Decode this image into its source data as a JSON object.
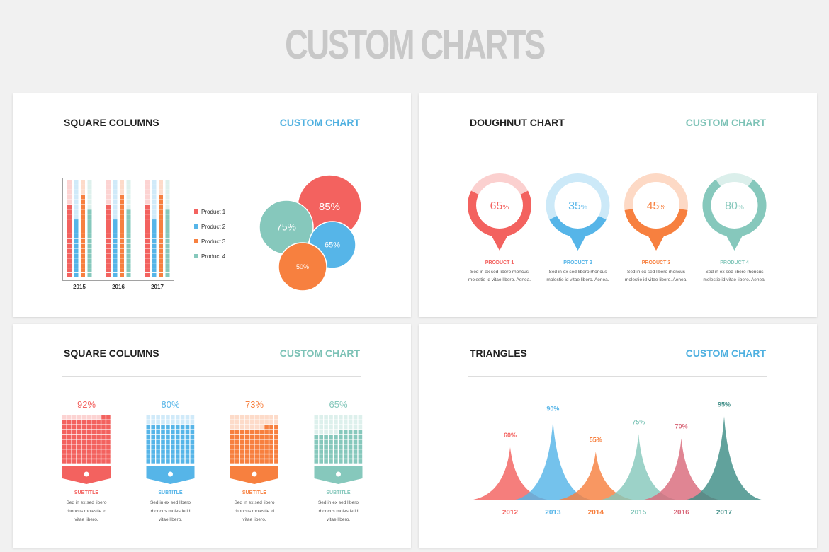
{
  "title": "CUSTOM CHARTS",
  "colors": {
    "red": "#f3625f",
    "blue": "#56b5e8",
    "orange": "#f7803f",
    "teal": "#86c8bc",
    "pink": "#d96a7b",
    "darkteal": "#3e8d86"
  },
  "panels": [
    {
      "title": "SQUARE COLUMNS",
      "subtitle": "CUSTOM CHART",
      "subtitle_color": "#4fb0e0"
    },
    {
      "title": "DOUGHNUT CHART",
      "subtitle": "CUSTOM CHART",
      "subtitle_color": "#7cc2b6"
    },
    {
      "title": "SQUARE COLUMNS",
      "subtitle": "CUSTOM CHART",
      "subtitle_color": "#7cc2b6"
    },
    {
      "title": "TRIANGLES",
      "subtitle": "CUSTOM CHART",
      "subtitle_color": "#4fb0e0"
    }
  ],
  "chart_data": [
    {
      "type": "bar",
      "categories": [
        "2015",
        "2016",
        "2017"
      ],
      "units_per_column": 20,
      "series": [
        {
          "name": "Product 1",
          "values": [
            15,
            15,
            15
          ]
        },
        {
          "name": "Product 2",
          "values": [
            12,
            12,
            12
          ]
        },
        {
          "name": "Product 3",
          "values": [
            17,
            17,
            17
          ]
        },
        {
          "name": "Product 4",
          "values": [
            14,
            14,
            14
          ]
        }
      ],
      "legend": "right"
    },
    {
      "type": "bubble",
      "labels": [
        "85%",
        "75%",
        "65%",
        "50%"
      ],
      "values": [
        85,
        75,
        65,
        50
      ],
      "colors": [
        "#f3625f",
        "#86c8bc",
        "#56b5e8",
        "#f7803f"
      ]
    },
    {
      "type": "pie",
      "variant": "doughnut",
      "items": [
        {
          "value": 65,
          "label": "65",
          "unit": "%",
          "name": "PRODUCT 1",
          "text": [
            "Sed in ex sed libero rhoncus",
            "molestie id vitae libero. Aenea."
          ]
        },
        {
          "value": 35,
          "label": "35",
          "unit": "%",
          "name": "PRODUCT 2",
          "text": [
            "Sed in ex sed libero rhoncus",
            "molestie id vitae libero. Aenea."
          ]
        },
        {
          "value": 45,
          "label": "45",
          "unit": "%",
          "name": "PRODUCT 3",
          "text": [
            "Sed in ex sed libero rhoncus",
            "molestie id vitae libero. Aenea."
          ]
        },
        {
          "value": 80,
          "label": "80",
          "unit": "%",
          "name": "PRODUCT 4",
          "text": [
            "Sed in ex sed libero rhoncus",
            "molestie id vitae libero. Aenea."
          ]
        }
      ]
    },
    {
      "type": "waffle",
      "items": [
        {
          "value": 92,
          "label": "92%",
          "icon": "drop-icon",
          "subtitle": "SUBTITLE",
          "text": [
            "Sed in ex sed libero",
            "rhoncus molestie id",
            "vitae libero."
          ]
        },
        {
          "value": 80,
          "label": "80%",
          "icon": "toggle-icon",
          "subtitle": "SUBTITLE",
          "text": [
            "Sed in ex sed libero",
            "rhoncus molestie id",
            "vitae libero."
          ]
        },
        {
          "value": 73,
          "label": "73%",
          "icon": "people-icon",
          "subtitle": "SUBTITLE",
          "text": [
            "Sed in ex sed libero",
            "rhoncus molestie id",
            "vitae libero."
          ]
        },
        {
          "value": 65,
          "label": "65%",
          "icon": "recycle-icon",
          "subtitle": "SUBTITLE",
          "text": [
            "Sed in ex sed libero",
            "rhoncus molestie id",
            "vitae libero."
          ]
        }
      ]
    },
    {
      "type": "area",
      "variant": "triangles",
      "categories": [
        "2012",
        "2013",
        "2014",
        "2015",
        "2016",
        "2017"
      ],
      "values": [
        60,
        90,
        55,
        75,
        70,
        95
      ],
      "labels": [
        "60%",
        "90%",
        "55%",
        "75%",
        "70%",
        "95%"
      ],
      "ylim": [
        0,
        100
      ]
    }
  ]
}
